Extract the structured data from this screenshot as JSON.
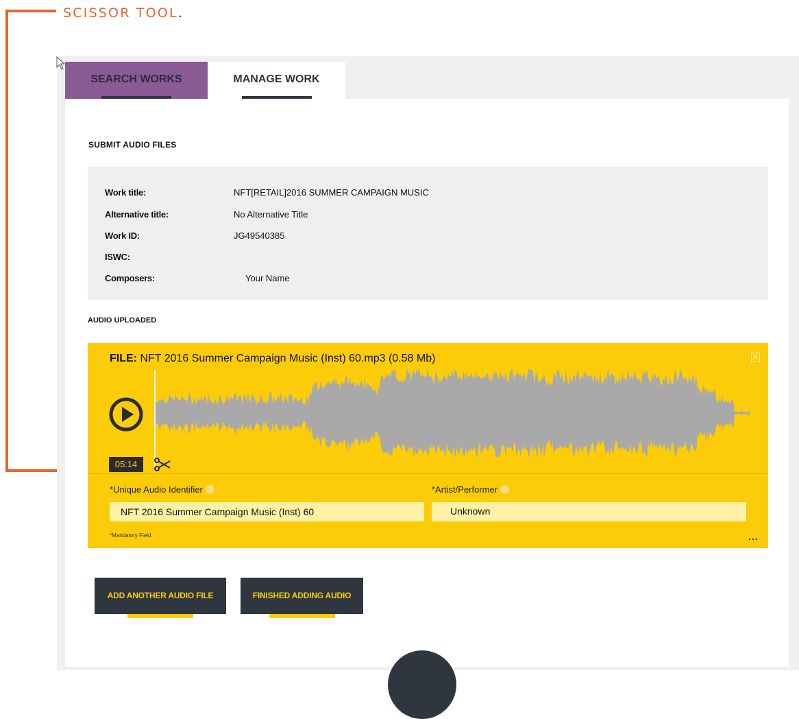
{
  "annotation": {
    "label": "SCISSOR TOOL",
    "punct": ".",
    "color": "#e8642e"
  },
  "tabs": [
    {
      "label": "SEARCH WORKS",
      "active": false
    },
    {
      "label": "MANAGE WORK",
      "active": true
    }
  ],
  "section_title": "SUBMIT AUDIO FILES",
  "work_info": [
    {
      "key": "Work title:",
      "value": "NFT[RETAIL]2016 SUMMER CAMPAIGN MUSIC"
    },
    {
      "key": "Alternative title:",
      "value": "No Alternative Title"
    },
    {
      "key": "Work ID:",
      "value": "JG49540385"
    },
    {
      "key": "ISWC:",
      "value": ""
    },
    {
      "key": "Composers:",
      "value": "Your Name"
    }
  ],
  "audio_heading": "AUDIO UPLOADED",
  "file": {
    "prefix": "FILE:",
    "name": " NFT 2016 Summer Campaign Music (Inst) 60.mp3 (0.58 Mb)",
    "close_label": "X",
    "time": "05:14",
    "fields": {
      "uai_label": "*Unique Audio Identifier",
      "uai_value": "NFT 2016 Summer Campaign Music (Inst) 60",
      "artist_label": "*Artist/Performer",
      "artist_value": "Unknown"
    },
    "mandatory": "*Mandatory Field",
    "more": "..."
  },
  "buttons": {
    "add": "ADD ANOTHER AUDIO FILE",
    "finish": "FINISHED ADDING AUDIO"
  },
  "colors": {
    "accent": "#fccc08",
    "dark": "#2f3640",
    "tab_inactive": "#8a5a96",
    "wave": "#a9a9aa"
  },
  "icons": [
    "cursor-arrow-icon",
    "play-icon",
    "scissors-icon",
    "info-icon",
    "close-icon"
  ]
}
